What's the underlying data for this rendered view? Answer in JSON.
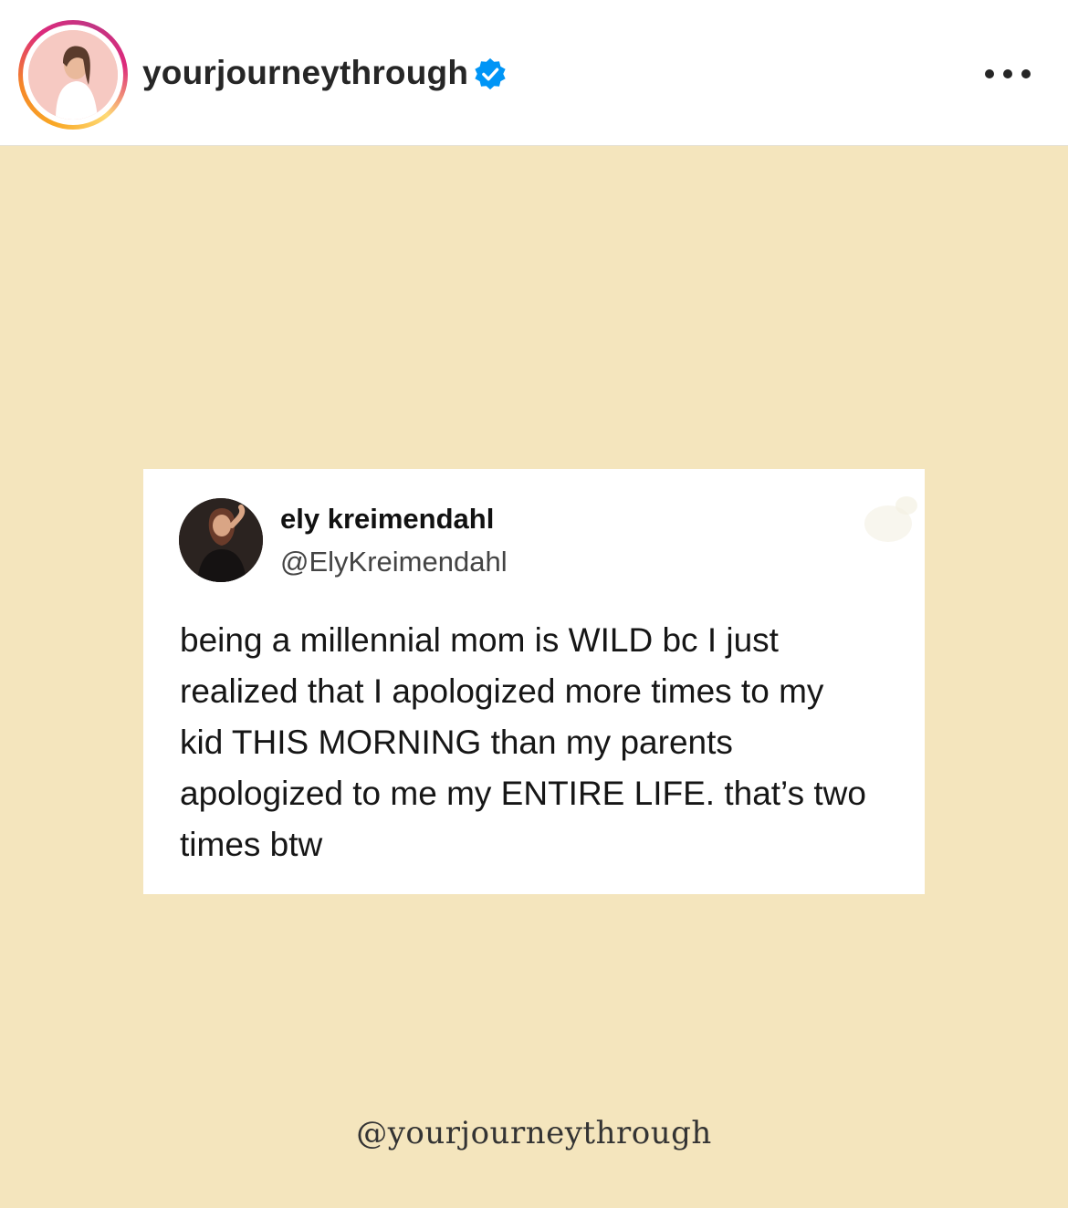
{
  "header": {
    "username": "yourjourneythrough",
    "verified_icon": "verified-badge-icon",
    "more_icon": "more-options-icon",
    "avatar_icon": "profile-avatar",
    "story_ring_colors": [
      "#feda75",
      "#f58529",
      "#dd2a7b",
      "#c13584"
    ],
    "verified_color": "#0095f6"
  },
  "post": {
    "background_color": "#f4e5bd",
    "tweet": {
      "display_name": "ely kreimendahl",
      "handle": "@ElyKreimendahl",
      "text": "being a millennial mom is WILD bc I just\nrealized that I apologized more times to my\nkid THIS MORNING than my parents\napologized to me my ENTIRE LIFE. that’s two\ntimes btw"
    },
    "watermark": "@yourjourneythrough"
  }
}
